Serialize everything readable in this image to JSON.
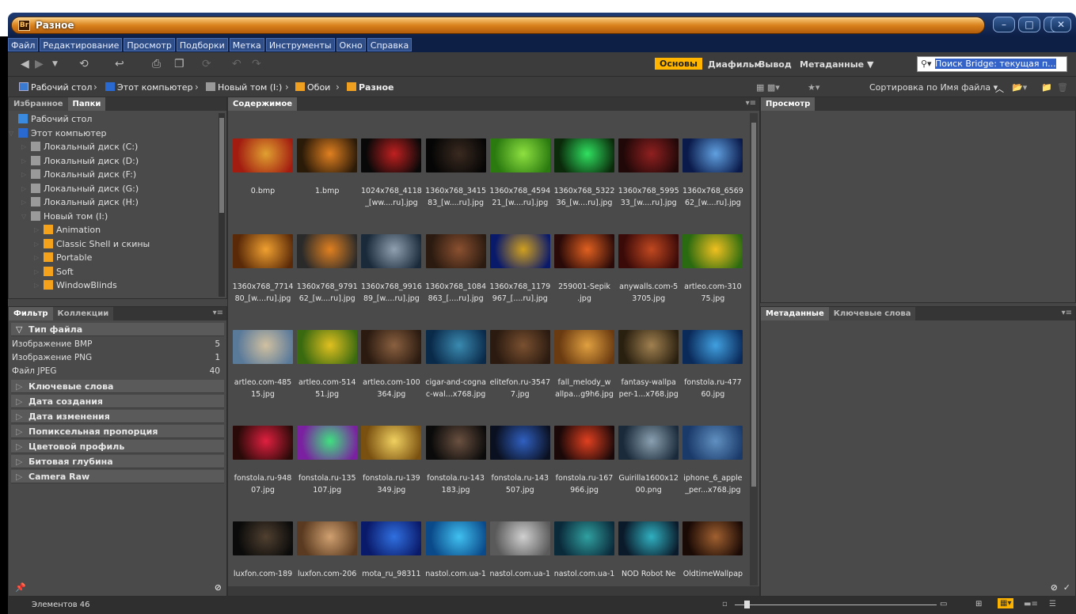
{
  "window": {
    "title": "Разное",
    "logo": "Br"
  },
  "menu": [
    "Файл",
    "Редактирование",
    "Просмотр",
    "Подборки",
    "Метка",
    "Инструменты",
    "Окно",
    "Справка"
  ],
  "workspaces": {
    "active": "Основы",
    "items": [
      "Диафильм",
      "Вывод",
      "Метаданные ▼"
    ]
  },
  "search": {
    "placeholder": "Поиск Bridge: текущая п..."
  },
  "breadcrumb": [
    "Рабочий стол",
    "Этот компьютер",
    "Новый том (I:)",
    "Обои",
    "Разное"
  ],
  "sort": {
    "label": "Сортировка по Имя файла ▾"
  },
  "left_top": {
    "tabs": [
      "Избранное",
      "Папки"
    ],
    "active_tab": "Папки"
  },
  "folders": [
    {
      "label": "Рабочий стол",
      "depth": 0,
      "icon": "desktop-icon"
    },
    {
      "label": "Этот компьютер",
      "depth": 0,
      "icon": "computer-icon"
    },
    {
      "label": "Локальный диск (C:)",
      "depth": 1,
      "icon": "drive-icon"
    },
    {
      "label": "Локальный диск (D:)",
      "depth": 1,
      "icon": "drive-icon"
    },
    {
      "label": "Локальный диск (F:)",
      "depth": 1,
      "icon": "drive-icon"
    },
    {
      "label": "Локальный диск (G:)",
      "depth": 1,
      "icon": "drive-icon"
    },
    {
      "label": "Локальный диск (H:)",
      "depth": 1,
      "icon": "drive-icon"
    },
    {
      "label": "Новый том (I:)",
      "depth": 1,
      "icon": "drive-icon"
    },
    {
      "label": "Animation",
      "depth": 2,
      "icon": "folder-icon"
    },
    {
      "label": "Classic Shell и скины",
      "depth": 2,
      "icon": "folder-icon"
    },
    {
      "label": "Portable",
      "depth": 2,
      "icon": "folder-icon"
    },
    {
      "label": "Soft",
      "depth": 2,
      "icon": "folder-icon"
    },
    {
      "label": "WindowBlinds",
      "depth": 2,
      "icon": "folder-icon"
    }
  ],
  "left_bottom": {
    "tabs": [
      "Фильтр",
      "Коллекции"
    ],
    "active_tab": "Фильтр"
  },
  "filter": {
    "file_type": {
      "title": "Тип файла",
      "rows": [
        {
          "label": "Изображение BMP",
          "count": "5"
        },
        {
          "label": "Изображение PNG",
          "count": "1"
        },
        {
          "label": "Файл JPEG",
          "count": "40"
        }
      ]
    },
    "sections": [
      "Ключевые слова",
      "Дата создания",
      "Дата изменения",
      "Попиксельная пропорция",
      "Цветовой профиль",
      "Битовая глубина",
      "Camera Raw"
    ]
  },
  "content": {
    "tab": "Содержимое"
  },
  "thumbs": [
    {
      "label": "0.bmp",
      "colors": [
        "#a21d10",
        "#e0a030"
      ]
    },
    {
      "label": "1.bmp",
      "colors": [
        "#2a1a08",
        "#e08020"
      ]
    },
    {
      "label": "1024x768_4118\n_[ww....ru].jpg",
      "colors": [
        "#080808",
        "#c02020"
      ]
    },
    {
      "label": "1360x768_3415\n83_[w....ru].jpg",
      "colors": [
        "#050505",
        "#3a2a20"
      ]
    },
    {
      "label": "1360x768_4594\n21_[w....ru].jpg",
      "colors": [
        "#2a7a10",
        "#8ee040"
      ]
    },
    {
      "label": "1360x768_5322\n36_[w....ru].jpg",
      "colors": [
        "#0a2a0a",
        "#30e060"
      ]
    },
    {
      "label": "1360x768_5995\n33_[w....ru].jpg",
      "colors": [
        "#200808",
        "#902020"
      ]
    },
    {
      "label": "1360x768_6569\n62_[w....ru].jpg",
      "colors": [
        "#0a1a4a",
        "#60a0e0"
      ]
    },
    {
      "label": "1360x768_7714\n80_[w....ru].jpg",
      "colors": [
        "#5a2a08",
        "#f0a030"
      ]
    },
    {
      "label": "1360x768_9791\n62_[w....ru].jpg",
      "colors": [
        "#2a2a2a",
        "#e08020"
      ]
    },
    {
      "label": "1360x768_9916\n89_[w....ru].jpg",
      "colors": [
        "#1a2a3a",
        "#90a0b0"
      ]
    },
    {
      "label": "1360x768_1084\n863_[....ru].jpg",
      "colors": [
        "#2a1a10",
        "#8a5030"
      ]
    },
    {
      "label": "1360x768_1179\n967_[....ru].jpg",
      "colors": [
        "#0a1a6a",
        "#d0a020"
      ]
    },
    {
      "label": "259001-Sepik\n.jpg",
      "colors": [
        "#2a0a08",
        "#e06020"
      ]
    },
    {
      "label": "anywalls.com-5\n3705.jpg",
      "colors": [
        "#3a0a08",
        "#c04820"
      ]
    },
    {
      "label": "artleo.com-310\n75.jpg",
      "colors": [
        "#2a6a10",
        "#f0c020"
      ]
    },
    {
      "label": "artleo.com-485\n15.jpg",
      "colors": [
        "#5a7a9a",
        "#d0c0a0"
      ]
    },
    {
      "label": "artleo.com-514\n51.jpg",
      "colors": [
        "#3a6a10",
        "#e0c020"
      ]
    },
    {
      "label": "artleo.com-100\n364.jpg",
      "colors": [
        "#2a1a10",
        "#8a6040"
      ]
    },
    {
      "label": "cigar-and-cogna\nc-wal...x768.jpg",
      "colors": [
        "#0a2a4a",
        "#3a8ab0"
      ]
    },
    {
      "label": "elitefon.ru-3547\n7.jpg",
      "colors": [
        "#2a1a10",
        "#7a5030"
      ]
    },
    {
      "label": "fall_melody_w\nallpa...g9h6.jpg",
      "colors": [
        "#6a3a10",
        "#e0a040"
      ]
    },
    {
      "label": "fantasy-wallpa\nper-1...x768.jpg",
      "colors": [
        "#2a2010",
        "#a08050"
      ]
    },
    {
      "label": "fonstola.ru-477\n60.jpg",
      "colors": [
        "#0a2a5a",
        "#40a0e0"
      ]
    },
    {
      "label": "fonstola.ru-948\n07.jpg",
      "colors": [
        "#2a0a08",
        "#e02040"
      ]
    },
    {
      "label": "fonstola.ru-135\n107.jpg",
      "colors": [
        "#7a20a0",
        "#40e080"
      ]
    },
    {
      "label": "fonstola.ru-139\n349.jpg",
      "colors": [
        "#7a5010",
        "#f0d060"
      ]
    },
    {
      "label": "fonstola.ru-143\n183.jpg",
      "colors": [
        "#0a0a0a",
        "#6a5040"
      ]
    },
    {
      "label": "fonstola.ru-143\n507.jpg",
      "colors": [
        "#0a1020",
        "#3060c0"
      ]
    },
    {
      "label": "fonstola.ru-167\n966.jpg",
      "colors": [
        "#1a0808",
        "#e04020"
      ]
    },
    {
      "label": "Guirilla1600x12\n00.png",
      "colors": [
        "#1a2a3a",
        "#8aa0b0"
      ]
    },
    {
      "label": "iphone_6_apple\n_per...x768.jpg",
      "colors": [
        "#1a3a6a",
        "#6090c0"
      ]
    },
    {
      "label": "luxfon.com-189\n...",
      "colors": [
        "#0a0a0a",
        "#504030"
      ]
    },
    {
      "label": "luxfon.com-206\n...",
      "colors": [
        "#5a3a20",
        "#d0a070"
      ]
    },
    {
      "label": "mota_ru_98311\n...",
      "colors": [
        "#0a1a6a",
        "#3070e0"
      ]
    },
    {
      "label": "nastol.com.ua-1\n...",
      "colors": [
        "#0a4a8a",
        "#40c0f0"
      ]
    },
    {
      "label": "nastol.com.ua-1\n...",
      "colors": [
        "#5a5a5a",
        "#d0d0d0"
      ]
    },
    {
      "label": "nastol.com.ua-1\n...",
      "colors": [
        "#0a2a3a",
        "#30a0a0"
      ]
    },
    {
      "label": "NOD Robot Ne\n...",
      "colors": [
        "#0a1a2a",
        "#30b0c0"
      ]
    },
    {
      "label": "OldtimeWallpap\n...",
      "colors": [
        "#1a0a05",
        "#a06030"
      ]
    }
  ],
  "right_top": {
    "tab": "Просмотр"
  },
  "right_bottom": {
    "tabs": [
      "Метаданные",
      "Ключевые слова"
    ]
  },
  "status": {
    "count": "Элементов 46"
  }
}
